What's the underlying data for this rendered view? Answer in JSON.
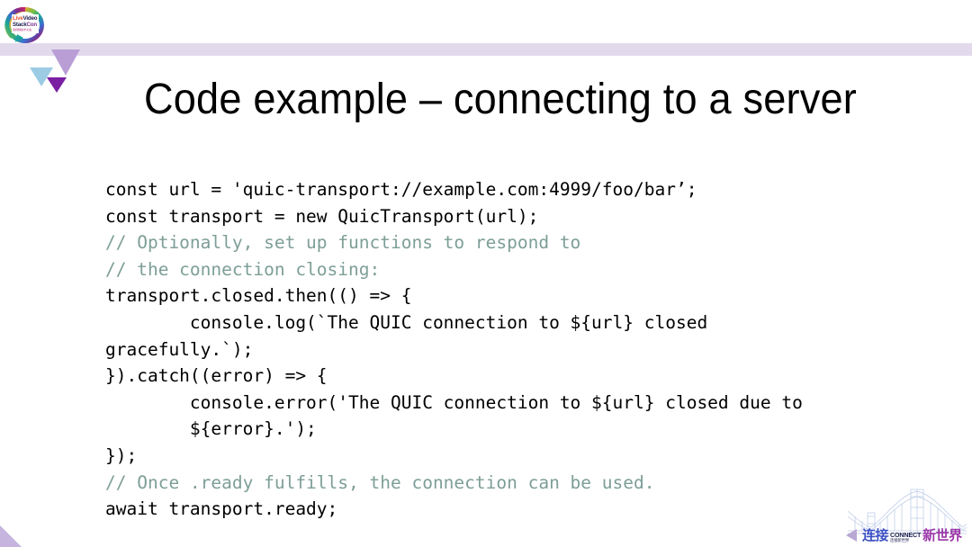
{
  "slide": {
    "title": "Code example – connecting to a server",
    "background_color": "#ffffff",
    "band_color": "#e2daec",
    "comment_color": "#7d9e97",
    "code_color": "#000000"
  },
  "logo": {
    "name": "LiveVideoStackCon",
    "line1_a": "Live",
    "line1_b": "Video",
    "line2_a": "Stack",
    "line2_b": "Con",
    "subtitle": "音视频技术大会",
    "ring_colors": [
      "#e8542f",
      "#f0a52c",
      "#7bbf44",
      "#1aa39a",
      "#3b6fd0",
      "#7b2f8f",
      "#c8246b"
    ]
  },
  "decor": {
    "triangle_large_color": "#b99ed6",
    "triangle_blue_color": "#9ccbe4",
    "triangle_purple_color": "#7a1fa2",
    "corner_triangle_color": "#c6b4de"
  },
  "code": {
    "language": "javascript",
    "lines": [
      {
        "text": "const url = 'quic-transport://example.com:4999/foo/bar’;",
        "type": "code"
      },
      {
        "text": "const transport = new QuicTransport(url);",
        "type": "code"
      },
      {
        "text": "// Optionally, set up functions to respond to",
        "type": "comment"
      },
      {
        "text": "// the connection closing:",
        "type": "comment"
      },
      {
        "text": "transport.closed.then(() => {",
        "type": "code"
      },
      {
        "text": "        console.log(`The QUIC connection to ${url} closed",
        "type": "code"
      },
      {
        "text": "gracefully.`);",
        "type": "code"
      },
      {
        "text": "}).catch((error) => {",
        "type": "code"
      },
      {
        "text": "        console.error('The QUIC connection to ${url} closed due to",
        "type": "code"
      },
      {
        "text": "        ${error}.');",
        "type": "code"
      },
      {
        "text": "});",
        "type": "code"
      },
      {
        "text": "// Once .ready fulfills, the connection can be used.",
        "type": "comment"
      },
      {
        "text": "await transport.ready;",
        "type": "code"
      }
    ]
  },
  "watermark": {
    "cn_left": "连接",
    "connect": "CONNECT",
    "connect_sub": "连接新世界",
    "cn_right": "新世界",
    "left_color": "#3b4fc4",
    "right_color": "#9b37a8"
  }
}
